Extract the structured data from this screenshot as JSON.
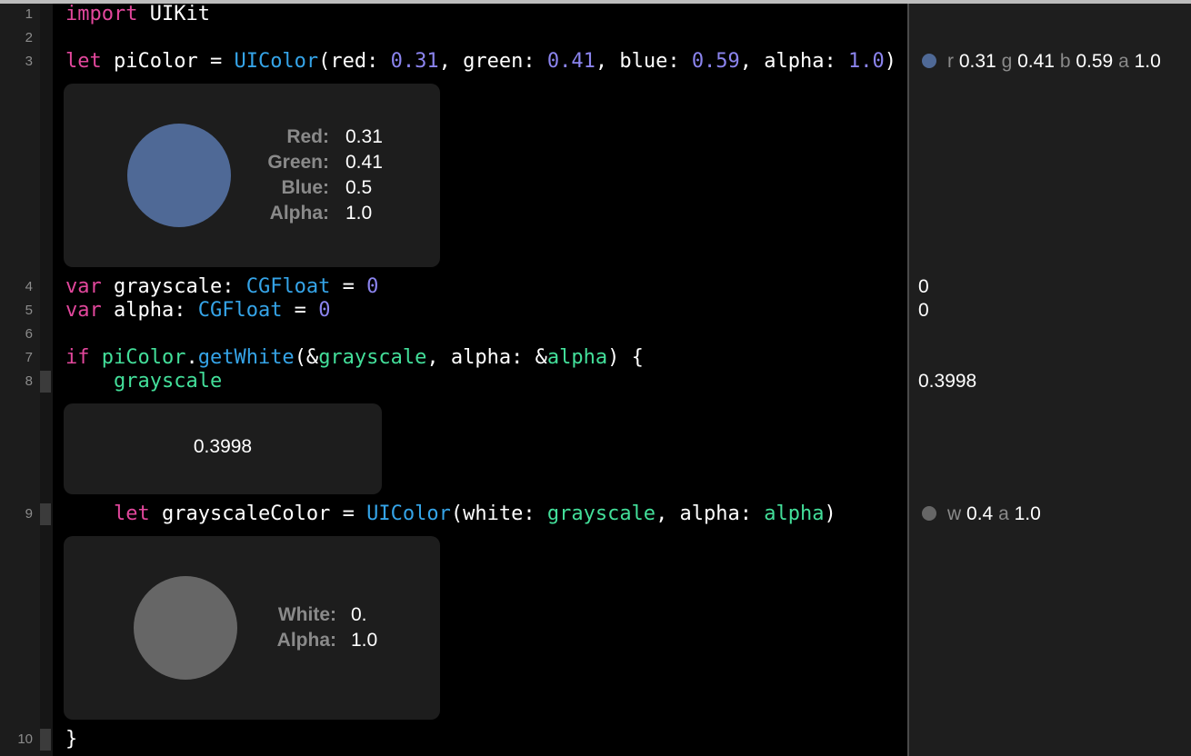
{
  "colors": {
    "keyword": "#e2479c",
    "type": "#35a4e8",
    "number": "#8b84ee",
    "variable": "#43df9a",
    "pi_color_swatch": "#4f6996",
    "grayscale_swatch": "#666666"
  },
  "line_numbers": [
    "1",
    "2",
    "3",
    "4",
    "5",
    "6",
    "7",
    "8",
    "9",
    "10"
  ],
  "code": {
    "l1": {
      "kw": "import",
      "rest": " UIKit"
    },
    "l3": {
      "kw": "let",
      "name": " piColor = ",
      "cls": "UIColor",
      "p1": "(red: ",
      "n1": "0.31",
      "p2": ", green: ",
      "n2": "0.41",
      "p3": ", blue: ",
      "n3": "0.59",
      "p4": ", alpha: ",
      "n4": "1.0",
      "p5": ")"
    },
    "l4": {
      "kw": "var",
      "name": " grayscale: ",
      "cls": "CGFloat",
      "eq": " = ",
      "num": "0"
    },
    "l5": {
      "kw": "var",
      "name": " alpha: ",
      "cls": "CGFloat",
      "eq": " = ",
      "num": "0"
    },
    "l7": {
      "kw": "if",
      "sp": " ",
      "v1": "piColor",
      "dot": ".",
      "fn": "getWhite",
      "p1": "(&",
      "v2": "grayscale",
      "p2": ", alpha: &",
      "v3": "alpha",
      "p3": ") {"
    },
    "l8": {
      "indent": "    ",
      "v": "grayscale"
    },
    "l9": {
      "indent": "    ",
      "kw": "let",
      "name": " grayscaleColor = ",
      "cls": "UIColor",
      "p1": "(white: ",
      "v1": "grayscale",
      "p2": ", alpha: ",
      "v2": "alpha",
      "p3": ")"
    },
    "l10": {
      "brace": "}"
    }
  },
  "card1": {
    "labels": [
      "Red:",
      "Green:",
      "Blue:",
      "Alpha:"
    ],
    "values": [
      "0.31",
      "0.41",
      "0.5",
      "1.0"
    ]
  },
  "card2": {
    "value": "0.3998"
  },
  "card3": {
    "labels": [
      "White:",
      "Alpha:"
    ],
    "values": [
      "0.",
      "1.0"
    ]
  },
  "results": {
    "r3": {
      "k1": "r",
      "v1": "0.31",
      "k2": "g",
      "v2": "0.41",
      "k3": "b",
      "v3": "0.59",
      "k4": "a",
      "v4": "1.0"
    },
    "r4": "0",
    "r5": "0",
    "r8": "0.3998",
    "r9": {
      "k1": "w",
      "v1": "0.4",
      "k2": "a",
      "v2": "1.0"
    }
  }
}
